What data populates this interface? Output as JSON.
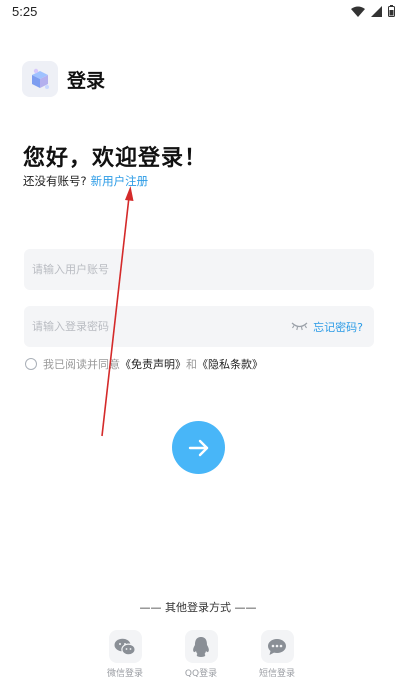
{
  "status_bar": {
    "time": "5:25"
  },
  "header": {
    "title": "登录"
  },
  "greeting": "您好，欢迎登录！",
  "signup": {
    "prompt": "还没有账号?",
    "link": "新用户注册"
  },
  "username": {
    "placeholder": "请输入用户账号"
  },
  "password": {
    "placeholder": "请输入登录密码",
    "forgot": "忘记密码?"
  },
  "agreement": {
    "text": "我已阅读并同意",
    "terms": "《免责声明》",
    "and": "和",
    "privacy": "《隐私条款》"
  },
  "other_login": {
    "title": "—— 其他登录方式 ——",
    "methods": [
      {
        "label": "微信登录",
        "icon": "wechat-icon"
      },
      {
        "label": "QQ登录",
        "icon": "qq-icon"
      },
      {
        "label": "短信登录",
        "icon": "sms-icon"
      }
    ]
  },
  "colors": {
    "accent": "#48b6f8",
    "link": "#2b9be6",
    "annotation": "#d42a2a"
  }
}
